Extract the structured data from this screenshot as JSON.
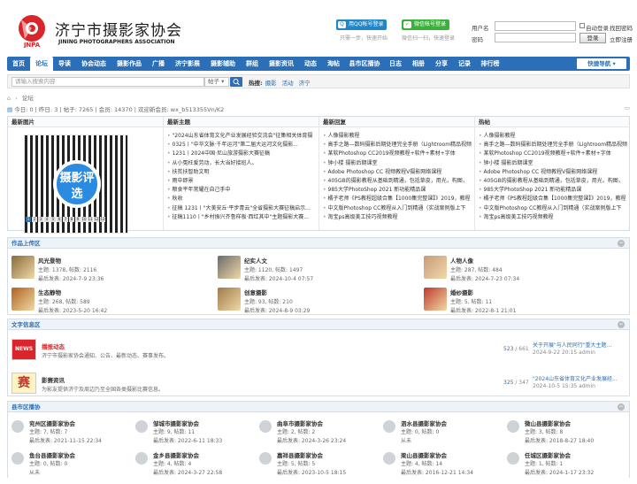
{
  "header": {
    "logo_cn": "济宁市摄影家协会",
    "logo_en": "JINING PHOTOGRAPHERS ASSOCIATION",
    "logo_mark": "JNPA",
    "qq_login": "用QQ帐号登录",
    "qq_tip": "只需一步，快速开始",
    "wx_login": "微信帐号登录",
    "wx_tip": "微信扫一扫，快速登录",
    "username_label": "用户名",
    "password_label": "密码",
    "auto_login": "自动登录",
    "forgot": "找回密码",
    "login_btn": "登录",
    "register": "立即注册"
  },
  "nav": {
    "items": [
      "首页",
      "论坛",
      "导读",
      "协会动态",
      "摄影作品",
      "广播",
      "济宁影展",
      "摄影辅助",
      "群组",
      "摄影资讯",
      "动态",
      "淘帖",
      "县市区播协",
      "日志",
      "相册",
      "分享",
      "记录",
      "排行榜"
    ],
    "active": "论坛",
    "quick": "快捷导航"
  },
  "search": {
    "placeholder": "请输入搜索内容",
    "type": "帖子",
    "hot_label": "热搜:",
    "hot": [
      "摄影",
      "活动",
      "济宁"
    ]
  },
  "breadcrumb": {
    "home": "⌂",
    "sep": "›",
    "current": "论坛"
  },
  "stats": {
    "text": "今日: 0 | 昨日: 3 | 帖子: 7265 | 会员: 14370 | 欢迎新会员: wx_b513355Vn/K2"
  },
  "top": {
    "latest_image": "最新图片",
    "qr_text": "摄影评选",
    "slides": [
      "1",
      "2",
      "3",
      "4",
      "5",
      "6",
      "7",
      "8",
      "9",
      "10",
      "11",
      "12",
      "13"
    ],
    "new_posts_title": "最新主题",
    "new_posts": [
      {
        "t": "\"2024山东省体育文化产业发展经验交流会\"征集相关体育摄",
        "c": ""
      },
      {
        "t": "0325丨\"中华文脉·千年运河\"第二届大运河文化摄影...",
        "c": "g"
      },
      {
        "t": "1231丨2024中国·尼山旅游摄影大赛征稿",
        "c": ""
      },
      {
        "t": "从小冤枉爱劳动，长大当好接班人。",
        "c": ""
      },
      {
        "t": "扶贫扶智助文明",
        "c": ""
      },
      {
        "t": "雨中即景",
        "c": ""
      },
      {
        "t": "粮食平年常耀在自己手中",
        "c": ""
      },
      {
        "t": "秋收",
        "c": ""
      },
      {
        "t": "征稿 1231丨\"大美安丘·平步青云\"全省摄影大赛征稿启示...",
        "c": "g"
      },
      {
        "t": "征稿1110丨\"乡村振兴齐鲁样板·西红其中\"主题摄影大赛...",
        "c": "g"
      }
    ],
    "new_replies_title": "最新回复",
    "new_replies": [
      "人像摄影教程",
      "高手之路—数码摄影后期处理完全手册（Lightroom精品视频",
      "某软Photoshop CC2019视频教程+软件+素材+字体",
      "钟小楼 摄影后期课堂",
      "Adobe Photoshop CC 视频教程V摄影网络课程",
      "405GB的摄影教程从基础到精通，包括草皮，用光，构图，",
      "985大学PhotoShop 2021 新功能精品课",
      "橘子老师《PS教程超级合集【1000集完整课】》2019，教程",
      "中文版Photoshop CC教程从入门到精通（实战案例版上下",
      "淘宝ps高级美工技巧视频教程"
    ],
    "hot_title": "热帖",
    "hot_posts": [
      "人像摄影教程",
      "高手之路—数码摄影后期处理完全手册（Lightroom精品视频",
      "某软Photoshop CC2019视频教程+软件+素材+字体",
      "钟小楼 摄影后期课堂",
      "Adobe Photoshop CC 视频教程V摄影网络课程",
      "405GB的摄影教程从基础到精通，包括草皮，用光，构图，",
      "985大学PhotoShop 2021 新功能精品课",
      "橘子老师《PS教程超级合集【1000集完整课】》2019，教程",
      "中文版Photoshop CC教程从入门到精通（实战案例版上下",
      "淘宝ps高级美工技巧视频教程"
    ]
  },
  "works": {
    "title": "作品上传区",
    "forums": [
      {
        "name": "风光景物",
        "stat": "主题: 1378, 帖数: 2116",
        "last": "最后发表: 2024-7-9 23:36",
        "color": "#8a6a3a"
      },
      {
        "name": "纪实人文",
        "stat": "主题: 1120, 帖数: 1497",
        "last": "最后发表: 2024-10-4 07:57",
        "color": "#6a6a6a"
      },
      {
        "name": "人物人像",
        "stat": "主题: 287, 帖数: 484",
        "last": "最后发表: 2024-7-23 07:34",
        "color": "#c89a7a"
      },
      {
        "name": "生态静物",
        "stat": "主题: 268, 帖数: 589",
        "last": "最后发表: 2023-5-20 16:42",
        "color": "#b0621e"
      },
      {
        "name": "创意摄影",
        "stat": "主题: 93, 帖数: 210",
        "last": "最后发表: 2024-8-9 03:29",
        "color": "#a07a4a"
      },
      {
        "name": "婚纱摄影",
        "stat": "主题: 5, 帖数: 11",
        "last": "最后发表: 2022-8-1 21:01",
        "color": "#c0392b"
      }
    ]
  },
  "news": {
    "title": "文字信息区",
    "forums": [
      {
        "name": "播报动态",
        "desc": "济宁市摄影家协会通知、公告、最新动态、赛事发布。",
        "count_a": "523",
        "count_b": "661",
        "last_title": "关于开展\"与人民同行\"重大主题...",
        "last_by": "2024-9-22 20:15 admin",
        "icon": "NEWS"
      },
      {
        "name": "影赛资讯",
        "desc": "为影友提供济宁及周边乃至全国各类摄影比赛信息。",
        "count_a": "325",
        "count_b": "347",
        "last_title": "\"2024山东省体育文化产业发展经...",
        "last_by": "2024-10-5 15:35 admin",
        "icon": "赛"
      }
    ]
  },
  "county": {
    "title": "县市区播协",
    "forums": [
      {
        "name": "兖州区摄影家协会",
        "stat": "主题: 7, 帖数: 7",
        "last": "最后发表: 2021-11-15 22:34"
      },
      {
        "name": "邹城市摄影家协会",
        "stat": "主题: 9, 帖数: 11",
        "last": "最后发表: 2022-6-11 18:33"
      },
      {
        "name": "曲阜市摄影家协会",
        "stat": "主题: 2, 帖数: 2",
        "last": "最后发表: 2024-3-26 23:24"
      },
      {
        "name": "泗水县摄影家协会",
        "stat": "主题: 0, 帖数: 0",
        "last": "从未"
      },
      {
        "name": "微山县摄影家协会",
        "stat": "主题: 3, 帖数: 8",
        "last": "最后发表: 2018-8-27 18:40"
      },
      {
        "name": "鱼台县摄影家协会",
        "stat": "主题: 0, 帖数: 0",
        "last": "从未"
      },
      {
        "name": "金乡县摄影家协会",
        "stat": "主题: 4, 帖数: 4",
        "last": "最后发表: 2024-3-27 22:58"
      },
      {
        "name": "嘉祥县摄影家协会",
        "stat": "主题: 5, 帖数: 5",
        "last": "最后发表: 2023-10-5 18:15"
      },
      {
        "name": "梁山县摄影家协会",
        "stat": "主题: 4, 帖数: 14",
        "last": "最后发表: 2016-12-21 14:34"
      },
      {
        "name": "任城区摄影家协会",
        "stat": "主题: 1, 帖数: 1",
        "last": "最后发表: 2024-1-17 23:32"
      }
    ]
  }
}
